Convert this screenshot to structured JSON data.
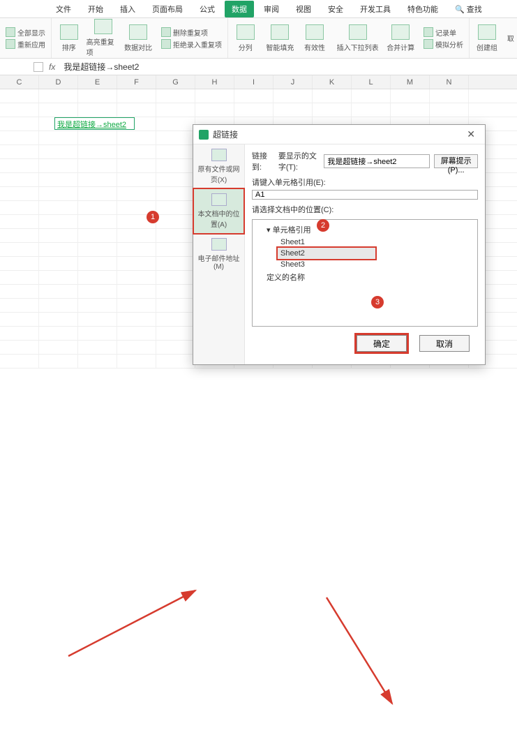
{
  "tabs": {
    "file": "文件",
    "home": "开始",
    "insert": "插入",
    "layout": "页面布局",
    "formula": "公式",
    "data": "数据",
    "review": "审阅",
    "view": "视图",
    "security": "安全",
    "dev": "开发工具",
    "special": "特色功能",
    "search": "查找"
  },
  "ribbon": {
    "showAll": "全部显示",
    "reapply": "重新应用",
    "sort": "排序",
    "highlight": "高亮重复项",
    "compare": "数据对比",
    "removeDup": "删除重复项",
    "rejectDup": "拒绝录入重复项",
    "split": "分列",
    "smartFill": "智能填充",
    "validity": "有效性",
    "insertDropdown": "插入下拉列表",
    "consolidate": "合并计算",
    "recordForm": "记录单",
    "whatIf": "模拟分析",
    "createGroup": "创建组",
    "cancel": "取"
  },
  "formulaBar": {
    "fx": "fx",
    "text": "我是超链接→sheet2"
  },
  "columns": [
    "C",
    "D",
    "E",
    "F",
    "G",
    "H",
    "I",
    "J",
    "K",
    "L",
    "M",
    "N"
  ],
  "cell": {
    "text": "我是超链接→sheet2"
  },
  "dialog": {
    "title": "超链接",
    "linkToLabel": "链接到:",
    "displayLabel": "要显示的文字(T):",
    "displayValue": "我是超链接→sheet2",
    "tipBtn": "屏幕提示(P)...",
    "refLabel": "请键入单元格引用(E):",
    "refValue": "A1",
    "placeLabel": "请选择文档中的位置(C):",
    "cellRefNode": "单元格引用",
    "sheet1": "Sheet1",
    "sheet2": "Sheet2",
    "sheet3": "Sheet3",
    "definedNames": "定义的名称",
    "leftTabs": {
      "existing": "原有文件或网页(X)",
      "place": "本文档中的位置(A)",
      "email": "电子邮件地址(M)"
    },
    "ok": "确定",
    "cancel": "取消"
  },
  "markers": {
    "m1": "1",
    "m2": "2",
    "m3": "3"
  }
}
